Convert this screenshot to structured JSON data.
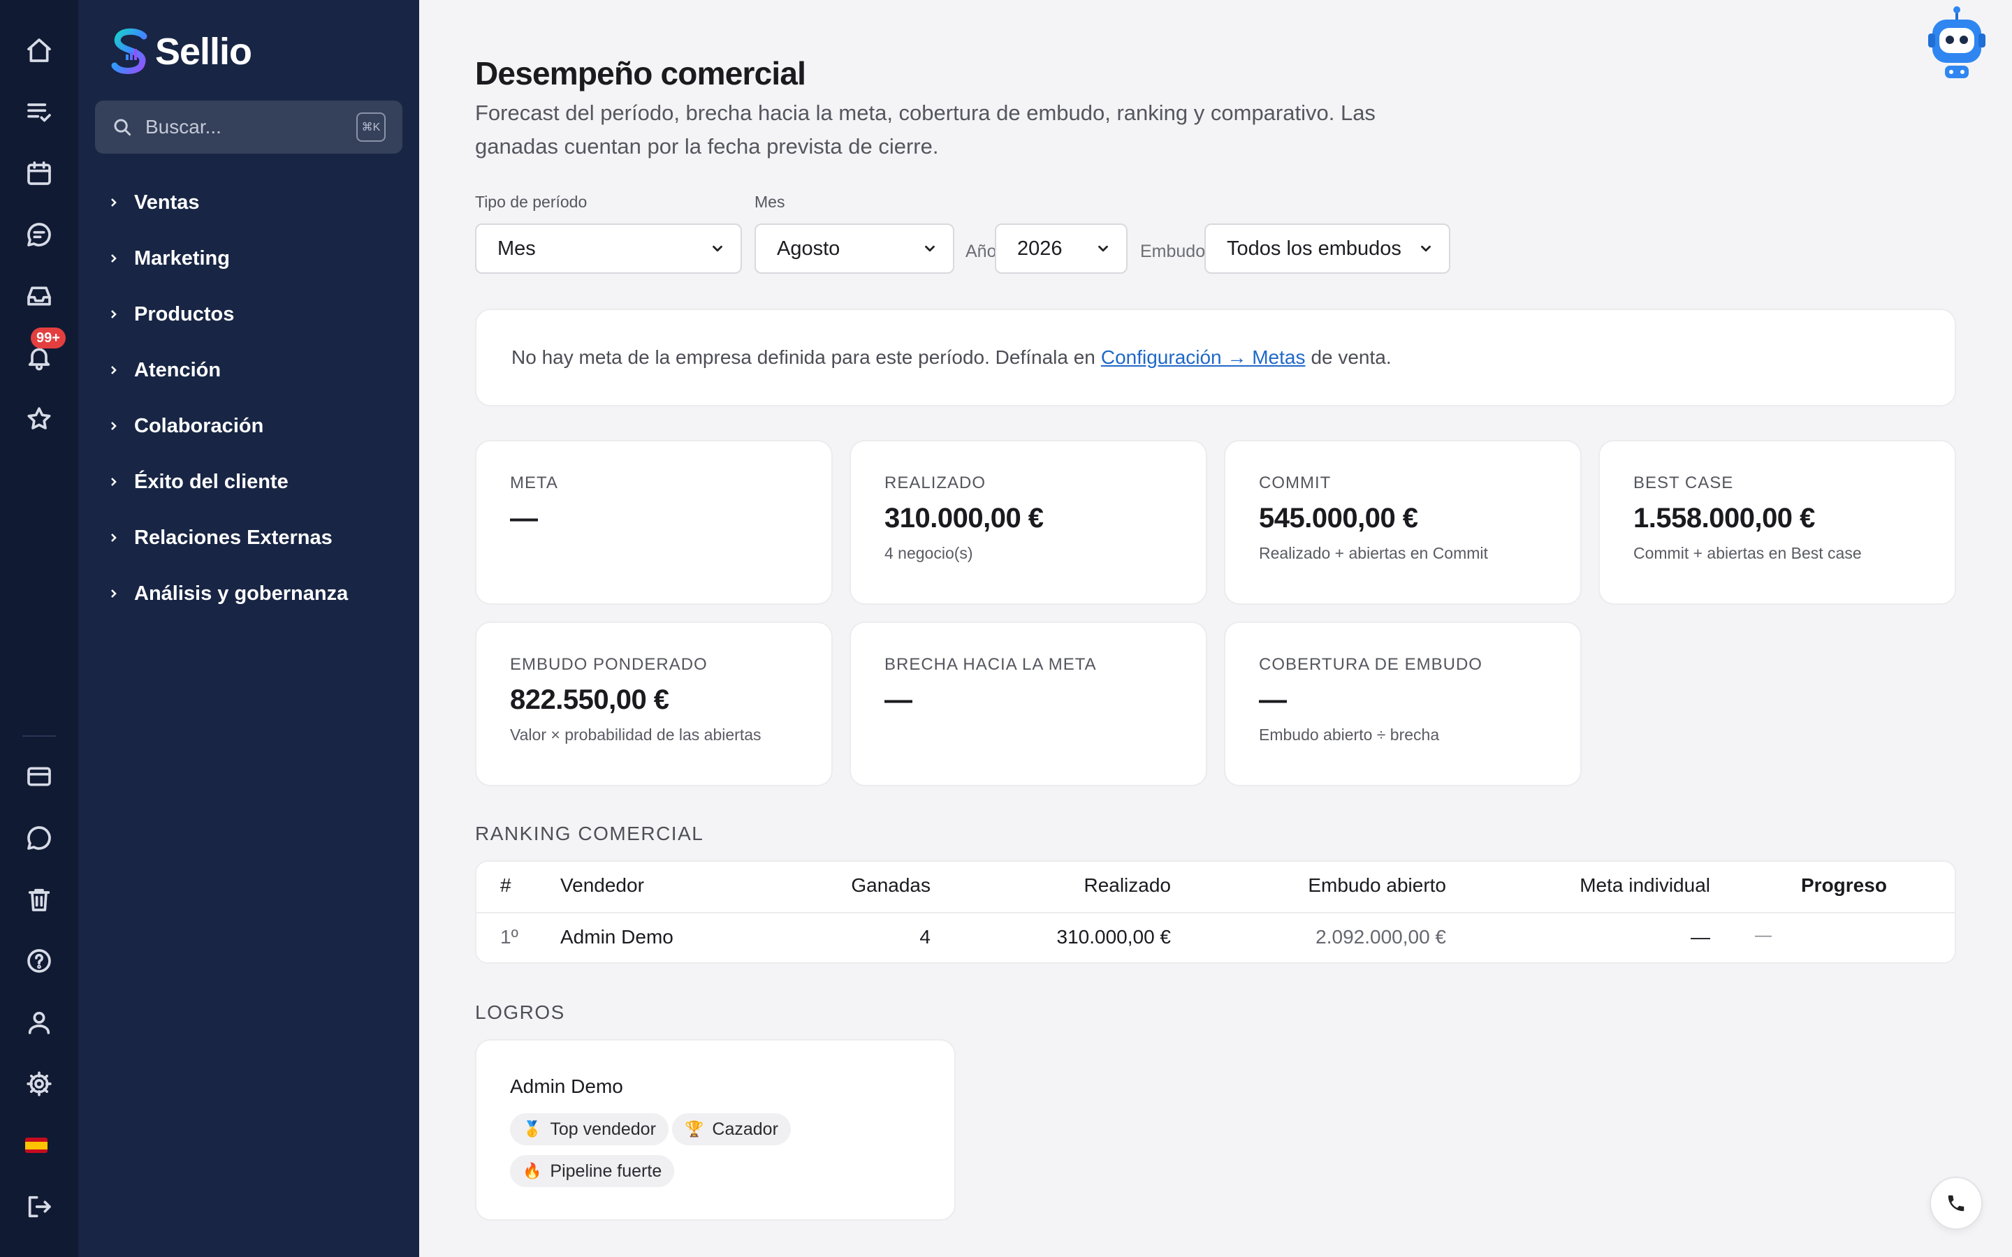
{
  "app": {
    "name": "Sellio"
  },
  "rail": {
    "badge": "99+",
    "icons": [
      "home-icon",
      "tasks-icon",
      "calendar-icon",
      "chat-icon",
      "inbox-icon",
      "bell-icon",
      "star-icon",
      "card-icon",
      "message-icon",
      "trash-icon",
      "help-icon",
      "user-icon",
      "settings-icon",
      "flag-es-icon",
      "logout-icon"
    ]
  },
  "sidebar": {
    "search_placeholder": "Buscar...",
    "search_shortcut": "⌘K",
    "items": [
      {
        "label": "Ventas"
      },
      {
        "label": "Marketing"
      },
      {
        "label": "Productos"
      },
      {
        "label": "Atención"
      },
      {
        "label": "Colaboración"
      },
      {
        "label": "Éxito del cliente"
      },
      {
        "label": "Relaciones Externas"
      },
      {
        "label": "Análisis y gobernanza"
      }
    ]
  },
  "header": {
    "title": "Desempeño comercial",
    "subtitle": "Forecast del período, brecha hacia la meta, cobertura de embudo, ranking y comparativo. Las ganadas cuentan por la fecha prevista de cierre."
  },
  "filters": {
    "period_type_label": "Tipo de período",
    "period_type_value": "Mes",
    "month_label": "Mes",
    "month_value": "Agosto",
    "year_label": "Año",
    "year_value": "2026",
    "funnel_label": "Embudo",
    "funnel_value": "Todos los embudos"
  },
  "notice": {
    "text_before": "No hay meta de la empresa definida para este período. Defínala en",
    "link": "Configuración → Metas",
    "text_after": "de venta."
  },
  "kpis": [
    {
      "label": "META",
      "value": "—",
      "sub": ""
    },
    {
      "label": "REALIZADO",
      "value": "310.000,00 €",
      "sub": "4 negocio(s)"
    },
    {
      "label": "COMMIT",
      "value": "545.000,00 €",
      "sub": "Realizado + abiertas en Commit"
    },
    {
      "label": "BEST CASE",
      "value": "1.558.000,00 €",
      "sub": "Commit + abiertas en Best case"
    },
    {
      "label": "EMBUDO PONDERADO",
      "value": "822.550,00 €",
      "sub": "Valor × probabilidad de las abiertas"
    },
    {
      "label": "BRECHA HACIA LA META",
      "value": "—",
      "sub": ""
    },
    {
      "label": "COBERTURA DE EMBUDO",
      "value": "—",
      "sub": "Embudo abierto ÷ brecha"
    }
  ],
  "ranking": {
    "title": "RANKING COMERCIAL",
    "columns": [
      "#",
      "Vendedor",
      "Ganadas",
      "Realizado",
      "Embudo abierto",
      "Meta individual",
      "Progreso"
    ],
    "rows": [
      {
        "rank": "1º",
        "seller": "Admin Demo",
        "won": "4",
        "achieved": "310.000,00 €",
        "open_funnel": "2.092.000,00 €",
        "individual_goal": "—",
        "progress": "—"
      }
    ]
  },
  "achievements": {
    "title": "LOGROS",
    "user": "Admin Demo",
    "badges": [
      {
        "emoji": "🥇",
        "label": "Top vendedor"
      },
      {
        "emoji": "🏆",
        "label": "Cazador"
      },
      {
        "emoji": "🔥",
        "label": "Pipeline fuerte"
      }
    ]
  },
  "colors": {
    "sidebar_bg": "#182544",
    "rail_bg": "#101a33",
    "link": "#1f68c8",
    "badge": "#e43f3f",
    "page_bg": "#f4f4f6"
  }
}
